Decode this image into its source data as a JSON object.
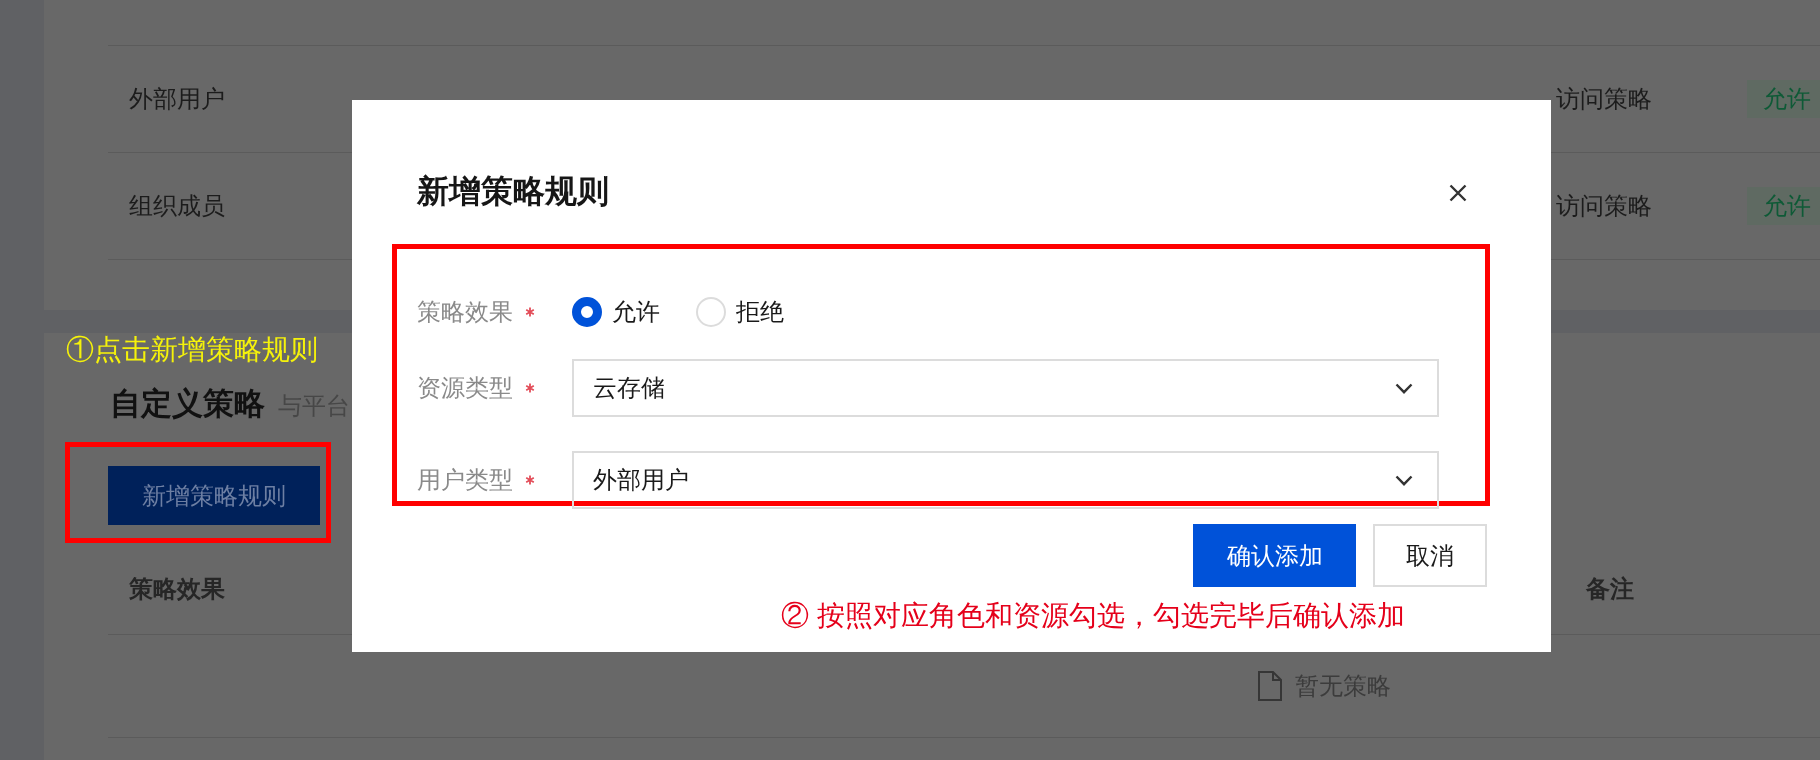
{
  "policy_table": {
    "rows": [
      {
        "user_type": "外部用户",
        "policy_name": "访问策略",
        "effect": "允许"
      },
      {
        "user_type": "组织成员",
        "policy_name": "访问策略",
        "effect": "允许"
      }
    ]
  },
  "custom_policy": {
    "annotation": "①点击新增策略规则",
    "title": "自定义策略",
    "subtitle": "与平台",
    "add_button": {
      "label": "新增策略规则",
      "highlighted": true
    },
    "table": {
      "columns": [
        "策略效果",
        "备注"
      ],
      "empty_text": "暂无策略"
    }
  },
  "dialog": {
    "title": "新增策略规则",
    "form_highlighted": true,
    "fields": [
      {
        "kind": "radio",
        "label": "策略效果",
        "required": true,
        "options": [
          {
            "label": "允许",
            "selected": true
          },
          {
            "label": "拒绝",
            "selected": false
          }
        ]
      },
      {
        "kind": "select",
        "label": "资源类型",
        "required": true,
        "value": "云存储"
      },
      {
        "kind": "select",
        "label": "用户类型",
        "required": true,
        "value": "外部用户"
      }
    ],
    "buttons": [
      {
        "kind": "primary",
        "label": "确认添加"
      },
      {
        "kind": "secondary",
        "label": "取消"
      }
    ],
    "annotation": "② 按照对应角色和资源勾选，勾选完毕后确认添加"
  }
}
